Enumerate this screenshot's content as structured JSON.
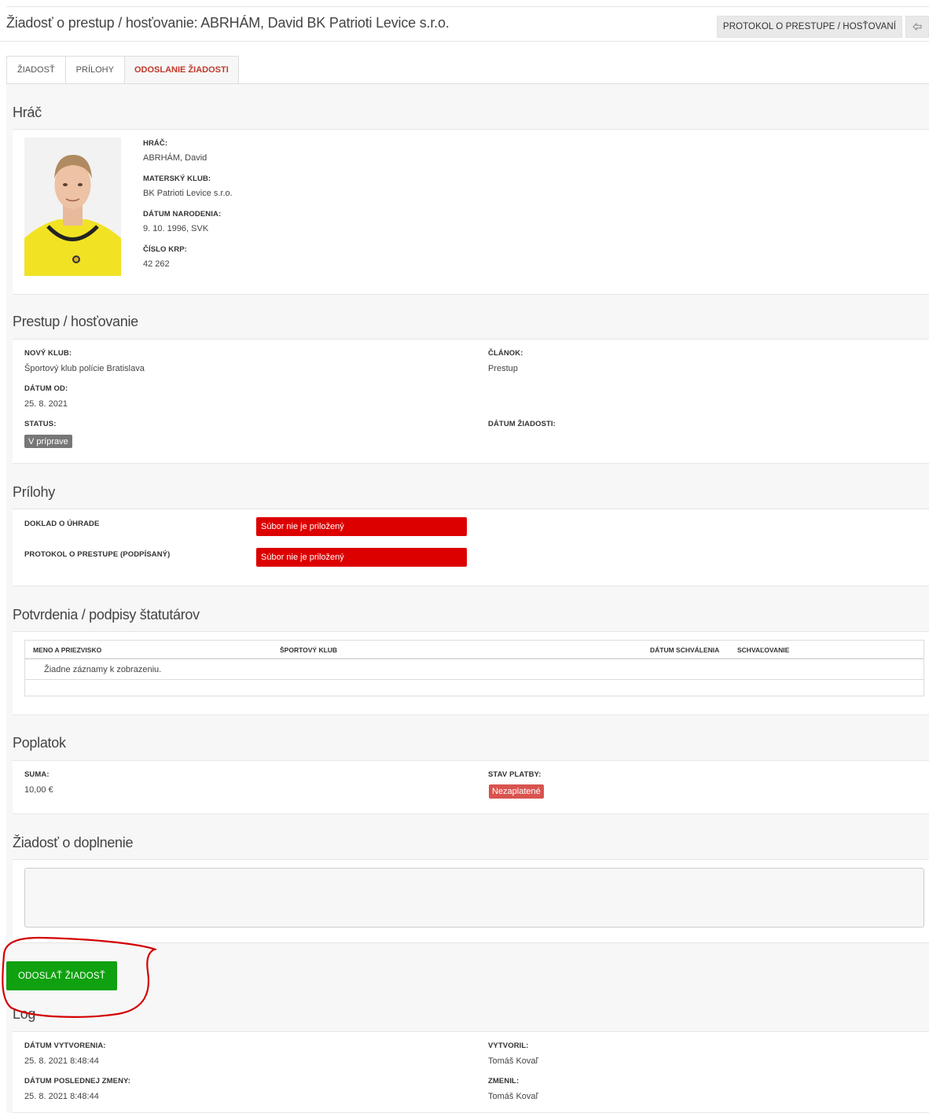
{
  "header": {
    "title": "Žiadosť o prestup / hosťovanie: ABRHÁM, David BK Patrioti Levice s.r.o.",
    "protocol_button": "PROTOKOL O PRESTUPE / HOSŤOVANÍ",
    "back_icon": "arrow-left-icon"
  },
  "tabs": [
    {
      "label": "ŽIADOSŤ"
    },
    {
      "label": "PRÍLOHY"
    },
    {
      "label": "ODOSLANIE ŽIADOSTI",
      "active": true
    }
  ],
  "player": {
    "section_title": "Hráč",
    "player_label": "HRÁČ:",
    "player_value": "ABRHÁM, David",
    "club_label": "MATERSKÝ KLUB:",
    "club_value": "BK Patrioti Levice s.r.o.",
    "birth_label": "DÁTUM NARODENIA:",
    "birth_value": "9. 10. 1996, SVK",
    "krp_label": "ČÍSLO KRP:",
    "krp_value": "42 262"
  },
  "transfer": {
    "section_title": "Prestup / hosťovanie",
    "new_club_label": "NOVÝ KLUB:",
    "new_club_value": "Športový klub polície Bratislava",
    "article_label": "ČLÁNOK:",
    "article_value": "Prestup",
    "date_from_label": "DÁTUM OD:",
    "date_from_value": "25. 8. 2021",
    "status_label": "STATUS:",
    "status_value": "V príprave",
    "request_date_label": "DÁTUM ŽIADOSTI:"
  },
  "attachments": {
    "section_title": "Prílohy",
    "items": [
      {
        "label": "DOKLAD O ÚHRADE",
        "status": "Súbor nie je priložený"
      },
      {
        "label": "PROTOKOL O PRESTUPE (PODPÍSANÝ)",
        "status": "Súbor nie je priložený"
      }
    ]
  },
  "confirmations": {
    "section_title": "Potvrdenia / podpisy štatutárov",
    "columns": [
      "MENO A PRIEZVISKO",
      "ŠPORTOVÝ KLUB",
      "DÁTUM SCHVÁLENIA",
      "SCHVAĽOVANIE"
    ],
    "empty_text": "Žiadne záznamy k zobrazeniu."
  },
  "fee": {
    "section_title": "Poplatok",
    "amount_label": "SUMA:",
    "amount_value": "10,00 €",
    "payment_label": "STAV PLATBY:",
    "payment_value": "Nezaplatené"
  },
  "supplement": {
    "section_title": "Žiadosť o doplnenie",
    "value": ""
  },
  "send_button": "ODOSLAŤ ŽIADOSŤ",
  "log": {
    "section_title": "Log",
    "created_label": "DÁTUM VYTVORENIA:",
    "created_value": "25. 8. 2021 8:48:44",
    "created_by_label": "VYTVORIL:",
    "created_by_value": "Tomáš Kovaľ",
    "modified_label": "DÁTUM POSLEDNEJ ZMENY:",
    "modified_value": "25. 8. 2021 8:48:44",
    "modified_by_label": "ZMENIL:",
    "modified_by_value": "Tomáš Kovaľ"
  },
  "colors": {
    "active_tab": "#c0392b",
    "send_button": "#0fa10f",
    "file_missing": "#dd0000",
    "unpaid_badge": "#d9534f",
    "status_badge": "#777777",
    "annotation": "#d40000"
  }
}
